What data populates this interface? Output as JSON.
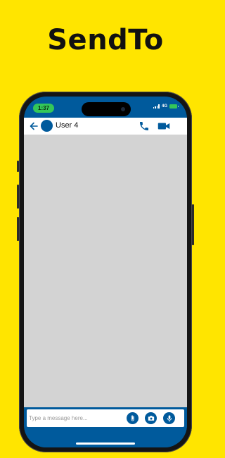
{
  "promo": {
    "headline": "SendTo"
  },
  "status_bar": {
    "time": "1:37",
    "network": "4G"
  },
  "chat_header": {
    "contact_name": "User 4",
    "icons": {
      "back": "arrow-left-icon",
      "avatar": "avatar-circle",
      "call": "phone-icon",
      "video": "video-camera-icon"
    }
  },
  "composer": {
    "placeholder": "Type a message here...",
    "value": "",
    "icons": {
      "attach": "paperclip-icon",
      "camera": "camera-icon",
      "voice": "microphone-icon"
    }
  },
  "colors": {
    "promo_background": "#FFE500",
    "brand_blue": "#005A9C",
    "message_area": "#D3D3D3",
    "time_pill": "#34C759"
  }
}
